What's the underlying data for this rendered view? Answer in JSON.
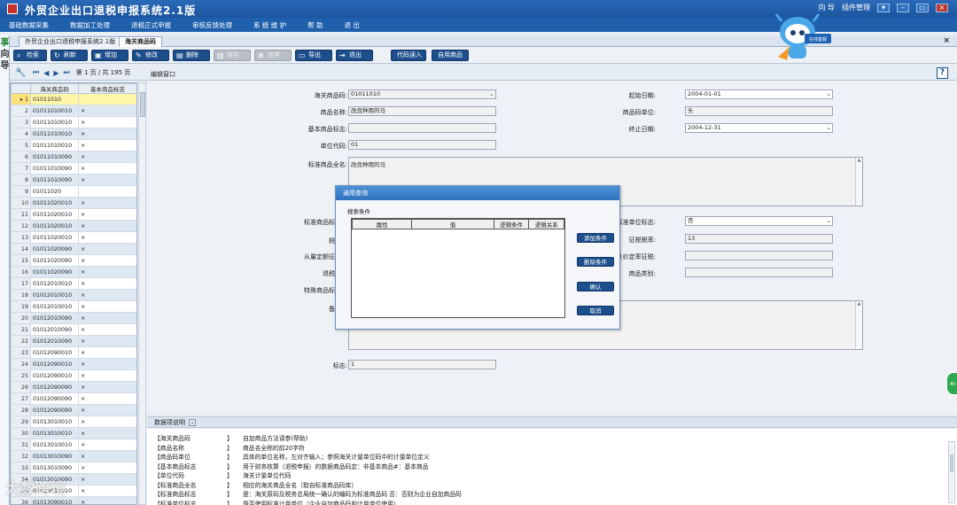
{
  "window": {
    "title": "外贸企业出口退税申报系统2.1版",
    "right_items": [
      "向 导",
      "插件管理"
    ]
  },
  "menu": [
    "基础数据采集",
    "数据加工处理",
    "退税正式申报",
    "审核反馈处理",
    "系 统 维 护",
    "帮 助",
    "退 出"
  ],
  "mascot": {
    "badge": "在线客服"
  },
  "left_strip": [
    "事",
    "向",
    "导"
  ],
  "tabs": [
    "外贸企业出口退税申报系统2.1版",
    "海关商品码"
  ],
  "toolbar": {
    "buttons": [
      {
        "label": "检索",
        "icon": "search-icon"
      },
      {
        "label": "刷新",
        "icon": "refresh-icon"
      },
      {
        "label": "增加",
        "icon": "add-icon"
      },
      {
        "label": "修改",
        "icon": "edit-icon"
      },
      {
        "label": "删除",
        "icon": "delete-icon"
      },
      {
        "label": "保存",
        "icon": "save-icon",
        "disabled": true
      },
      {
        "label": "放弃",
        "icon": "cancel-icon",
        "disabled": true
      },
      {
        "label": "导出",
        "icon": "export-icon"
      },
      {
        "label": "退出",
        "icon": "exit-icon"
      },
      {
        "label": "代码读入"
      },
      {
        "label": "自用商品"
      }
    ]
  },
  "pager": {
    "text": "第 1 页 / 共 195 页"
  },
  "grid": {
    "headers": [
      "海关商品码",
      "基本商品标志"
    ],
    "rows": [
      [
        "01011010",
        ""
      ],
      [
        "01011010010",
        "×"
      ],
      [
        "01011010010",
        "×"
      ],
      [
        "01011010010",
        "×"
      ],
      [
        "01011010010",
        "×"
      ],
      [
        "01011010090",
        "×"
      ],
      [
        "01011010090",
        "×"
      ],
      [
        "01011010090",
        "×"
      ],
      [
        "01011020",
        ""
      ],
      [
        "01011020010",
        "×"
      ],
      [
        "01011020010",
        "×"
      ],
      [
        "01011020010",
        "×"
      ],
      [
        "01011020010",
        "×"
      ],
      [
        "01011020090",
        "×"
      ],
      [
        "01011020090",
        "×"
      ],
      [
        "01011020090",
        "×"
      ],
      [
        "01012010010",
        "×"
      ],
      [
        "01012010010",
        "×"
      ],
      [
        "01012010010",
        "×"
      ],
      [
        "01012010090",
        "×"
      ],
      [
        "01012010090",
        "×"
      ],
      [
        "01012010090",
        "×"
      ],
      [
        "01012090010",
        "×"
      ],
      [
        "01012090010",
        "×"
      ],
      [
        "01012090010",
        "×"
      ],
      [
        "01012090090",
        "×"
      ],
      [
        "01012090090",
        "×"
      ],
      [
        "01012090090",
        "×"
      ],
      [
        "01013010010",
        "×"
      ],
      [
        "01013010010",
        "×"
      ],
      [
        "01013010010",
        "×"
      ],
      [
        "01013010090",
        "×"
      ],
      [
        "01013010090",
        "×"
      ],
      [
        "01013010090",
        "×"
      ],
      [
        "01013010010",
        "×"
      ],
      [
        "01013090010",
        "×"
      ]
    ]
  },
  "edit": {
    "header": "编辑窗口",
    "fields": {
      "hs_code": {
        "label": "海关商品码:",
        "value": "01011010"
      },
      "name": {
        "label": "商品名称:",
        "value": "改良种用的马"
      },
      "basic_flag": {
        "label": "基本商品标志:",
        "value": ""
      },
      "unit_code": {
        "label": "单位代码:",
        "value": "01"
      },
      "full_name": {
        "label": "标准商品全名:",
        "value": "改良种用的马"
      },
      "start_date": {
        "label": "起始日期:",
        "value": "2004-01-01"
      },
      "unit": {
        "label": "商品码单位:",
        "value": "头"
      },
      "end_date": {
        "label": "终止日期:",
        "value": "2004-12-31"
      },
      "std_flag_label": {
        "label": "标准商品标"
      },
      "std_unit_flag": {
        "label": "标准单位标志:",
        "value": "否"
      },
      "tax_label": {
        "label": "税"
      },
      "tax_rate": {
        "label": "征税税率:",
        "value": "13"
      },
      "quota_label": {
        "label": "从量定额征"
      },
      "ad_valorem": {
        "label": "从价定率征税:",
        "value": ""
      },
      "refund_label": {
        "label": "退税"
      },
      "category": {
        "label": "商品类别:",
        "value": ""
      },
      "special_label": {
        "label": "特殊商品标"
      },
      "remark_label": {
        "label": "备"
      },
      "mark": {
        "label": "标志:",
        "value": "1"
      }
    }
  },
  "dialog": {
    "title": "通用查询",
    "subtitle": "搜索条件",
    "columns": [
      "属性",
      "值",
      "逻辑条件",
      "逻辑关系"
    ],
    "buttons": [
      "添加条件",
      "删除条件",
      "确认",
      "取消"
    ]
  },
  "info": {
    "header": "数据项说明",
    "rows": [
      [
        "【海关商品码",
        "】",
        "自加商品方法请参(帮助)"
      ],
      [
        "【商品名称",
        "】",
        "商品名全称的前20字符"
      ],
      [
        "【商品码单位",
        "】",
        "具体的单位名称，左对齐输入；参照海关计量单位码中的计量单位定义"
      ],
      [
        "【基本商品标志",
        "】",
        "用于财务核算（退税申报）的数据商品码定：非基本商品#：基本商品"
      ],
      [
        "【单位代码",
        "】",
        "海关计量单位代码"
      ],
      [
        "【标准商品全名",
        "】",
        "相应的海关商品全名（取自标准商品码库）"
      ],
      [
        "【标准商品标志",
        "】",
        "是：海关原码及税务总局统一确认的编码为标准商品码 否：否则为企业自加商品码"
      ],
      [
        "【标准单位标志",
        "】",
        "是否使用标准计量单位（企业自加商品码和计量单位使用）"
      ]
    ]
  },
  "watermark": "大数跨境",
  "side_badge": "40"
}
